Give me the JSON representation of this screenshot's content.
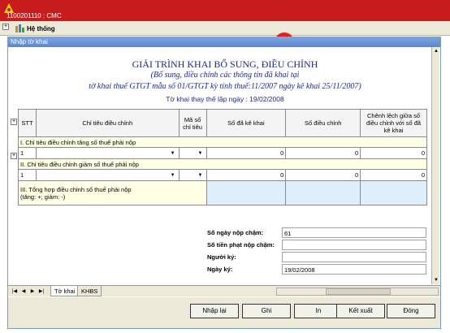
{
  "app": {
    "title": "1100201110 : CMC"
  },
  "menubar": {
    "system_label": "Hệ thống"
  },
  "window": {
    "title": "Nhập tờ khai"
  },
  "header": {
    "title": "GIẢI TRÌNH KHAI BỔ SUNG, ĐIỀU CHỈNH",
    "subtitle": "(Bổ sung, điều chỉnh các thông tin đã khai tại",
    "subtitle2": "tờ khai thuế GTGT mẫu số 01/GTGT kỳ tính thuế:11/2007 ngày kê khai 25/11/2007)",
    "replacement_date_text": "Tờ khai thay thế lập ngày : 19/02/2008"
  },
  "table": {
    "columns": [
      "STT",
      "Chỉ tiêu điều chỉnh",
      "Mã số chỉ tiêu",
      "Số đã kê khai",
      "Số điều chỉnh",
      "Chênh lệch giữa số điều chỉnh với số đã kê khai"
    ],
    "section1": "I. Chỉ tiêu điều chỉnh tăng số thuế phải nộp",
    "section1_row": {
      "stt": "1",
      "declared": "0",
      "adjusted": "0",
      "diff": "0"
    },
    "section2": "II. Chỉ tiêu điều chỉnh giảm số thuế phải nộp",
    "section2_row": {
      "stt": "1",
      "declared": "0",
      "adjusted": "0",
      "diff": "0"
    },
    "section3_line1": "III. Tổng hợp điều chỉnh số thuế phải nộp",
    "section3_line2": "(tăng: +; giảm: -)"
  },
  "info": {
    "late_days_label": "Số ngày nộp chậm:",
    "late_days_value": "61",
    "penalty_label": "Số tiền phạt nộp chậm:",
    "penalty_value": "",
    "signer_label": "Người ký:",
    "signer_value": "",
    "sign_date_label": "Ngày ký:",
    "sign_date_value": "19/02/2008"
  },
  "tabs": {
    "tab1": "Tờ khai",
    "tab2": "KHBS"
  },
  "buttons": {
    "import_label": "Nhập lại",
    "save_label": "Ghi",
    "print_label": "In",
    "export_label": "Kết xuất",
    "close_label": "Đóng"
  },
  "colors": {
    "app_titlebar": "#c81c1c",
    "header_text": "#1a2a8a",
    "section_bg": "#ffffe6",
    "total_bg": "#dfeefb"
  }
}
